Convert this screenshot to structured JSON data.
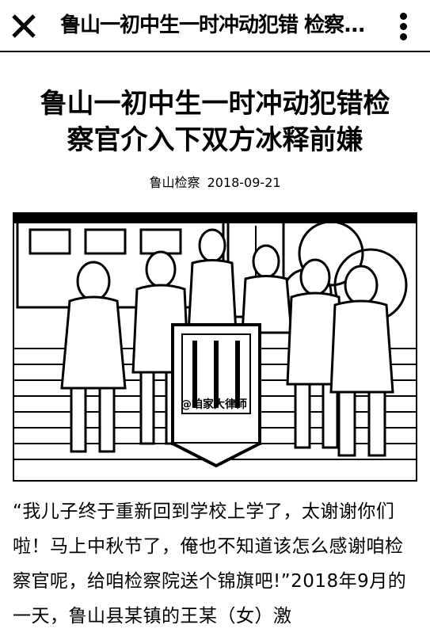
{
  "topbar": {
    "title": "鲁山一初中生一时冲动犯错 检察...",
    "close_icon": "close-icon",
    "more_icon": "more-vertical-icon"
  },
  "article": {
    "title": "鲁山一初中生一时冲动犯错检察官介入下双方冰释前嫌",
    "source": "鲁山检察",
    "date": "2018-09-21",
    "image_watermark": "@咱家大律师",
    "body": "“我儿子终于重新回到学校上学了，太谢谢你们啦！马上中秋节了，俺也不知道该怎么感谢咱检察官呢，给咱检察院送个锦旗吧!”2018年9月的一天，鲁山县某镇的王某（女）激"
  }
}
